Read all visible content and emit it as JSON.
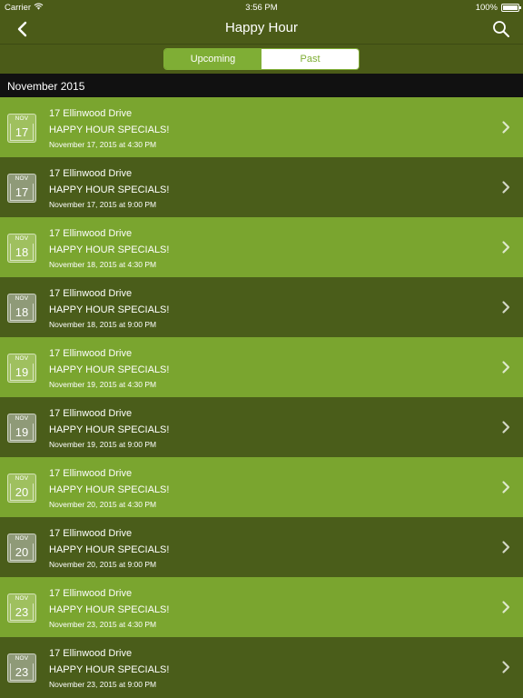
{
  "status_bar": {
    "carrier": "Carrier",
    "time": "3:56 PM",
    "battery": "100%",
    "battery_level": 1.0
  },
  "nav": {
    "title": "Happy Hour"
  },
  "segments": [
    {
      "label": "Upcoming",
      "selected": true
    },
    {
      "label": "Past",
      "selected": false
    }
  ],
  "section": {
    "header": "November 2015"
  },
  "events": [
    {
      "month": "NOV",
      "day": "17",
      "location": "17 Ellinwood Drive",
      "title": "HAPPY HOUR SPECIALS!",
      "datetime": "November 17, 2015 at 4:30 PM"
    },
    {
      "month": "NOV",
      "day": "17",
      "location": "17 Ellinwood Drive",
      "title": "HAPPY HOUR SPECIALS!",
      "datetime": "November 17, 2015 at 9:00 PM"
    },
    {
      "month": "NOV",
      "day": "18",
      "location": "17 Ellinwood Drive",
      "title": "HAPPY HOUR SPECIALS!",
      "datetime": "November 18, 2015 at 4:30 PM"
    },
    {
      "month": "NOV",
      "day": "18",
      "location": "17 Ellinwood Drive",
      "title": "HAPPY HOUR SPECIALS!",
      "datetime": "November 18, 2015 at 9:00 PM"
    },
    {
      "month": "NOV",
      "day": "19",
      "location": "17 Ellinwood Drive",
      "title": "HAPPY HOUR SPECIALS!",
      "datetime": "November 19, 2015 at 4:30 PM"
    },
    {
      "month": "NOV",
      "day": "19",
      "location": "17 Ellinwood Drive",
      "title": "HAPPY HOUR SPECIALS!",
      "datetime": "November 19, 2015 at 9:00 PM"
    },
    {
      "month": "NOV",
      "day": "20",
      "location": "17 Ellinwood Drive",
      "title": "HAPPY HOUR SPECIALS!",
      "datetime": "November 20, 2015 at 4:30 PM"
    },
    {
      "month": "NOV",
      "day": "20",
      "location": "17 Ellinwood Drive",
      "title": "HAPPY HOUR SPECIALS!",
      "datetime": "November 20, 2015 at 9:00 PM"
    },
    {
      "month": "NOV",
      "day": "23",
      "location": "17 Ellinwood Drive",
      "title": "HAPPY HOUR SPECIALS!",
      "datetime": "November 23, 2015 at 4:30 PM"
    },
    {
      "month": "NOV",
      "day": "23",
      "location": "17 Ellinwood Drive",
      "title": "HAPPY HOUR SPECIALS!",
      "datetime": "November 23, 2015 at 9:00 PM"
    }
  ],
  "colors": {
    "nav_bg": "#4b5b18",
    "row_light": "#7aa52f",
    "row_dark": "#4a5d1a",
    "accent": "#7fae35",
    "section_bg": "#111111"
  },
  "icons": {
    "back": "chevron-left-icon",
    "search": "search-icon",
    "disclosure": "chevron-right-icon",
    "wifi": "wifi-icon",
    "battery": "battery-icon"
  }
}
